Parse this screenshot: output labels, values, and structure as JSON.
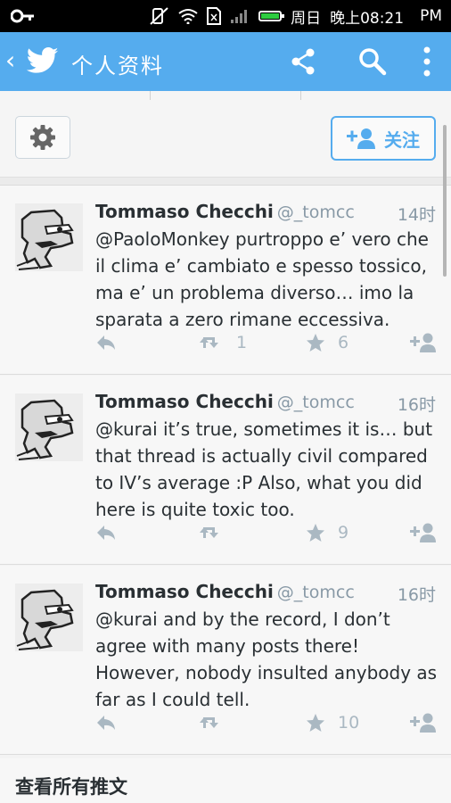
{
  "status_bar": {
    "day": "周日",
    "time": "晚上08:21",
    "ampm": "PM"
  },
  "app_bar": {
    "title": "个人资料"
  },
  "profile_actions": {
    "follow_label": "关注"
  },
  "tweets": [
    {
      "name": "Tommaso Checchi",
      "handle": "@_tomcc",
      "time": "14时",
      "text": "@PaoloMonkey purtroppo e’ vero che il clima e’ cambiato e spesso tossico, ma e’ un problema diverso… imo la sparata a zero rimane eccessiva.",
      "retweets": "1",
      "favorites": "6"
    },
    {
      "name": "Tommaso Checchi",
      "handle": "@_tomcc",
      "time": "16时",
      "text": "@kurai it’s true, sometimes it is… but that thread is actually civil compared to IV’s average :P Also, what you did here is quite toxic too.",
      "retweets": "",
      "favorites": "9"
    },
    {
      "name": "Tommaso Checchi",
      "handle": "@_tomcc",
      "time": "16时",
      "text": "@kurai and by the record, I don’t agree with many posts there! However, nobody insulted anybody as far as I could tell.",
      "retweets": "",
      "favorites": "10"
    }
  ],
  "footer": {
    "view_all_label": "查看所有推文"
  },
  "colors": {
    "accent": "#55acee",
    "action_gray": "#aab8c2"
  }
}
